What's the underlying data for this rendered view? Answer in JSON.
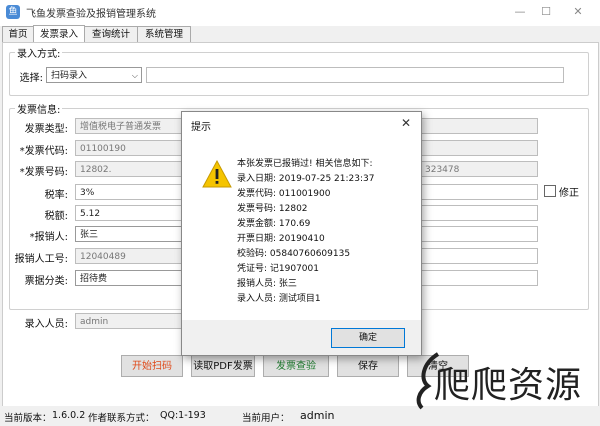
{
  "window": {
    "title": "飞鱼发票查验及报销管理系统",
    "controls": {
      "minimize": "—",
      "maximize": "☐",
      "close": "✕"
    }
  },
  "tabs": [
    "首页",
    "发票录入",
    "查询统计",
    "系统管理"
  ],
  "entry_method": {
    "group_label": "录入方式:",
    "select_label": "选择:",
    "select_value": "扫码录入",
    "input_value": ""
  },
  "invoice": {
    "group_label": "发票信息:",
    "type_label": "发票类型:",
    "type_value": "增值税电子普通发票",
    "code_label": "*发票代码:",
    "code_value": "01100190",
    "number_label": "*发票号码:",
    "number_value": "12802.",
    "right_partial_value": "323478",
    "tax_rate_label": "税率:",
    "tax_rate_value": "3%",
    "tax_amount_label": "税额:",
    "tax_amount_value": "5.12",
    "reimburser_label": "*报销人:",
    "reimburser_value": "张三",
    "reimburser_id_label": "报销人工号:",
    "reimburser_id_value": "12040489",
    "category_label": "票据分类:",
    "category_value": "招待费",
    "modify_label": "修正"
  },
  "entry_person": {
    "label": "录入人员:",
    "value": "admin"
  },
  "buttons": {
    "scan": "开始扫码",
    "pdf": "读取PDF发票",
    "verify": "发票查验",
    "save": "保存",
    "clear": "清空"
  },
  "status": {
    "version_label": "当前版本：",
    "version": "1.6.0.2",
    "author_label": "作者联系方式：",
    "author_value": "QQ:1-193",
    "user_label": "当前用户：",
    "user": "admin"
  },
  "dialog": {
    "title": "提示",
    "lines": [
      "本张发票已报销过! 相关信息如下:",
      "录入日期: 2019-07-25 21:23:37",
      "发票代码: 011001900",
      "发票号码: 12802",
      "发票金额: 170.69",
      "开票日期: 20190410",
      "校验码: 05840760609135",
      "凭证号: 记1907001",
      "报销人员: 张三",
      "录入人员: 测试项目1"
    ],
    "ok": "确定"
  },
  "watermark": "爬爬资源",
  "colors": {
    "scan_button_text": "#e04a1a",
    "accent": "#0078d7",
    "warning": "#f5c400"
  }
}
